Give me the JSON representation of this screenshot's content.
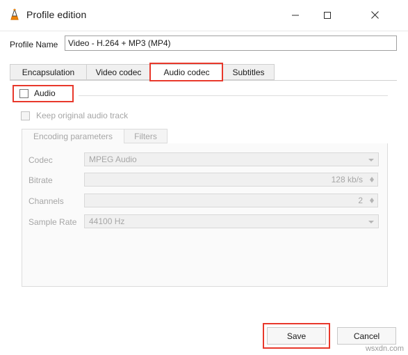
{
  "window": {
    "title": "Profile edition",
    "icon": "vlc-cone-icon",
    "controls": {
      "minimize": "minimize-icon",
      "maximize": "maximize-icon",
      "close": "close-icon"
    }
  },
  "profile_name": {
    "label": "Profile Name",
    "value": "Video - H.264 + MP3 (MP4)"
  },
  "tabs": [
    {
      "label": "Encapsulation",
      "active": false
    },
    {
      "label": "Video codec",
      "active": false
    },
    {
      "label": "Audio codec",
      "active": true
    },
    {
      "label": "Subtitles",
      "active": false
    }
  ],
  "audio": {
    "checkbox_label": "Audio",
    "checked": false,
    "keep_original_label": "Keep original audio track",
    "keep_original_checked": false
  },
  "inner_tabs": [
    {
      "label": "Encoding parameters",
      "active": true
    },
    {
      "label": "Filters",
      "active": false
    }
  ],
  "fields": {
    "codec": {
      "label": "Codec",
      "value": "MPEG Audio"
    },
    "bitrate": {
      "label": "Bitrate",
      "value": "128 kb/s"
    },
    "channels": {
      "label": "Channels",
      "value": "2"
    },
    "sample_rate": {
      "label": "Sample Rate",
      "value": "44100 Hz"
    }
  },
  "footer": {
    "save": "Save",
    "cancel": "Cancel"
  },
  "watermark": "wsxdn.com",
  "colors": {
    "highlight": "#e8382b",
    "accent": "#ff8800"
  }
}
